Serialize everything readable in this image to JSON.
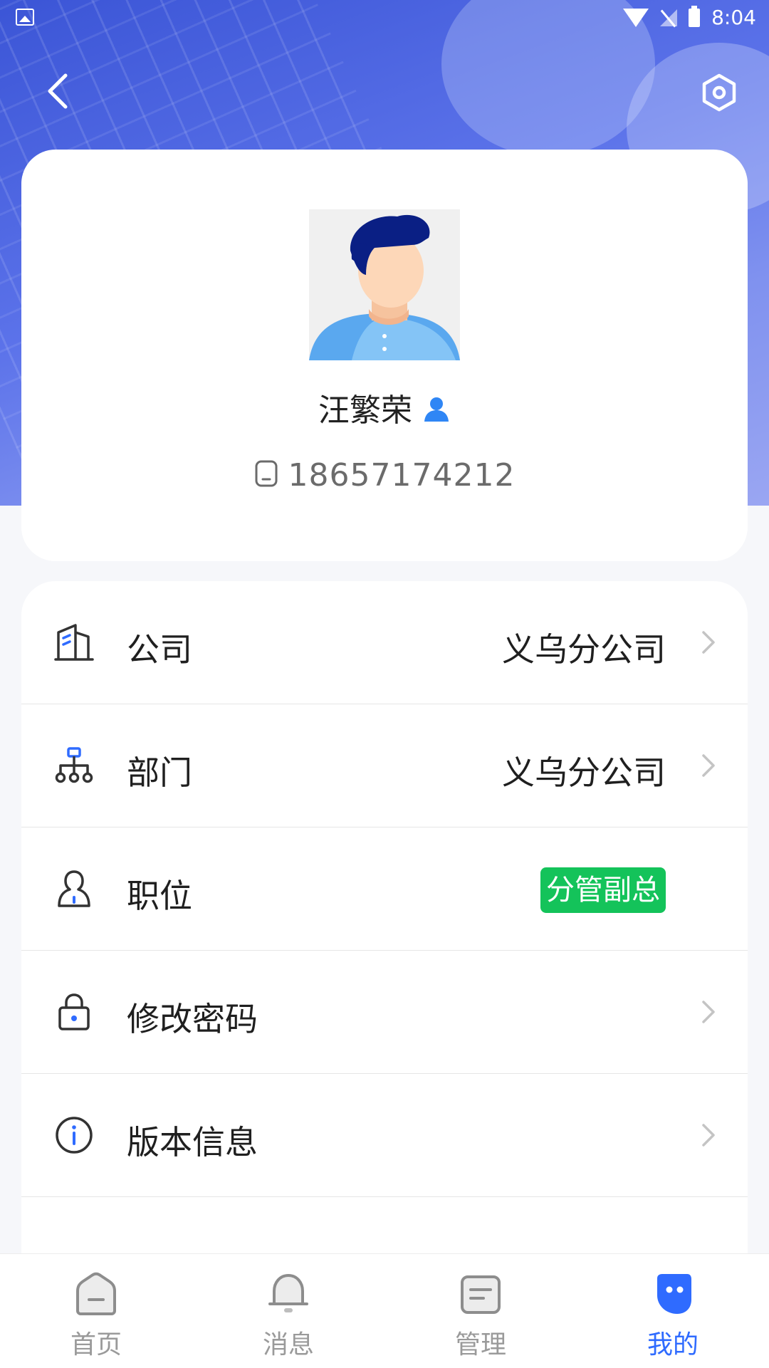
{
  "status_bar": {
    "time": "8:04"
  },
  "profile": {
    "name": "汪繁荣",
    "phone": "18657174212"
  },
  "menu": {
    "items": [
      {
        "label": "公司",
        "value": "义乌分公司",
        "icon": "building-icon"
      },
      {
        "label": "部门",
        "value": "义乌分公司",
        "icon": "org-chart-icon"
      },
      {
        "label": "职位",
        "badge": "分管副总",
        "badge_color": "#14c35a",
        "icon": "person-outline-icon"
      },
      {
        "label": "修改密码",
        "icon": "lock-icon"
      },
      {
        "label": "版本信息",
        "icon": "info-icon"
      }
    ]
  },
  "tabbar": {
    "items": [
      {
        "label": "首页",
        "icon": "home-icon"
      },
      {
        "label": "消息",
        "icon": "bell-icon"
      },
      {
        "label": "管理",
        "icon": "document-icon"
      },
      {
        "label": "我的",
        "icon": "profile-icon",
        "active": true
      }
    ],
    "active_color": "#2f6bff",
    "inactive_color": "#9a9a9a"
  }
}
